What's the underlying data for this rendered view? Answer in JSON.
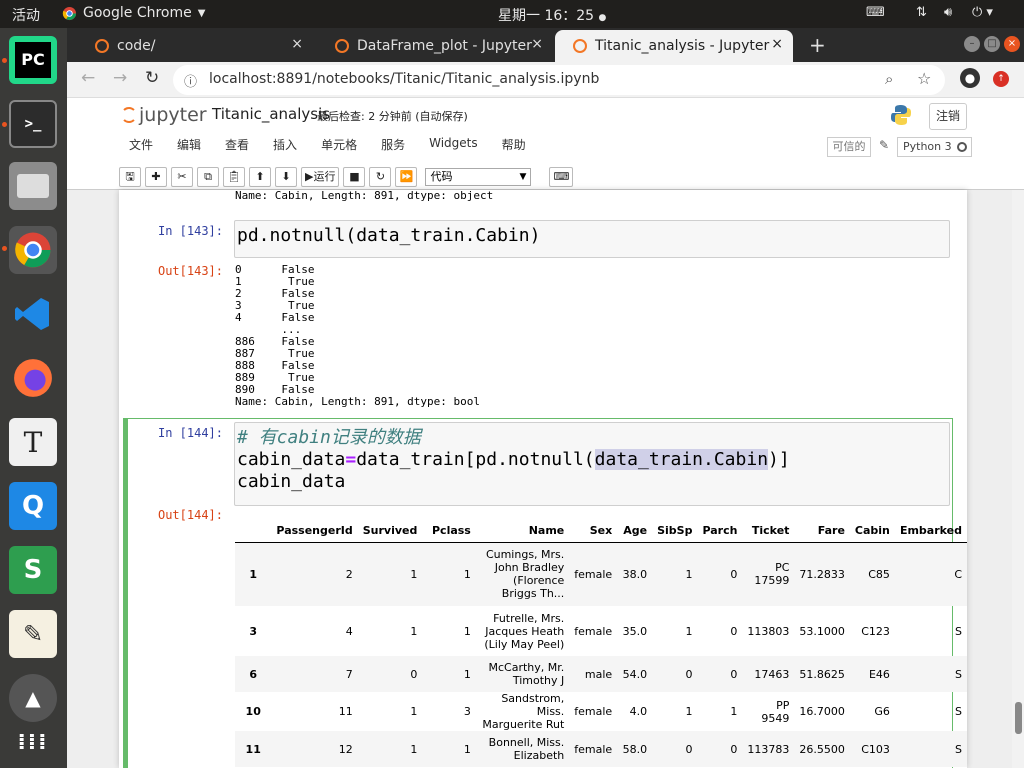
{
  "system": {
    "activities": "活动",
    "app_name": "Google Chrome",
    "clock": "星期一 16：25"
  },
  "dock": {
    "items": [
      "pycharm-icon",
      "terminal-icon",
      "files-icon",
      "chrome-icon",
      "vscode-icon",
      "firefox-icon",
      "typora-icon",
      "qq-icon",
      "spreadsheet-icon",
      "text-editor-icon",
      "software-updater-icon",
      "app-grid-icon"
    ]
  },
  "browser": {
    "tabs": [
      {
        "title": "code/",
        "close": "×"
      },
      {
        "title": "DataFrame_plot - Jupyter",
        "close": "×"
      },
      {
        "title": "Titanic_analysis - Jupyter",
        "close": "×"
      }
    ],
    "new_tab": "+",
    "url": "localhost:8891/notebooks/Titanic/Titanic_analysis.ipynb"
  },
  "jupyter": {
    "logo": "jupyter",
    "notebook_name": "Titanic_analysis",
    "checkpoint": "最后检查: 2 分钟前 (自动保存)",
    "logout": "注销",
    "menu": [
      "文件",
      "编辑",
      "查看",
      "插入",
      "单元格",
      "服务",
      "Widgets",
      "帮助"
    ],
    "trusted": "可信的",
    "kernel": "Python 3",
    "toolbar": {
      "run": "▶运行",
      "cell_type": "代码"
    }
  },
  "cells": {
    "prev_out_tail": "Name: Cabin, Length: 891, dtype: object",
    "c143": {
      "in_prompt": "In [143]:",
      "code": "pd.notnull(data_train.Cabin)",
      "out_prompt": "Out[143]:",
      "output": "0      False\n1       True\n2      False\n3       True\n4      False\n       ...\n886    False\n887     True\n888    False\n889     True\n890    False\nName: Cabin, Length: 891, dtype: bool"
    },
    "c144": {
      "in_prompt": "In [144]:",
      "comment": "# 有cabin记录的数据",
      "line2_a": "cabin_data",
      "line2_eq": "=",
      "line2_b": "data_train[pd.notnull(",
      "line2_hl": "data_train.Cabin",
      "line2_c": ")]",
      "line3": "cabin_data",
      "out_prompt": "Out[144]:"
    }
  },
  "dataframe": {
    "columns": [
      "",
      "PassengerId",
      "Survived",
      "Pclass",
      "Name",
      "Sex",
      "Age",
      "SibSp",
      "Parch",
      "Ticket",
      "Fare",
      "Cabin",
      "Embarked"
    ],
    "rows": [
      [
        "1",
        "2",
        "1",
        "1",
        "Cumings, Mrs. John Bradley (Florence Briggs Th...",
        "female",
        "38.0",
        "1",
        "0",
        "PC 17599",
        "71.2833",
        "C85",
        "C"
      ],
      [
        "3",
        "4",
        "1",
        "1",
        "Futrelle, Mrs. Jacques Heath (Lily May Peel)",
        "female",
        "35.0",
        "1",
        "0",
        "113803",
        "53.1000",
        "C123",
        "S"
      ],
      [
        "6",
        "7",
        "0",
        "1",
        "McCarthy, Mr. Timothy J",
        "male",
        "54.0",
        "0",
        "0",
        "17463",
        "51.8625",
        "E46",
        "S"
      ],
      [
        "10",
        "11",
        "1",
        "3",
        "Sandstrom, Miss. Marguerite Rut",
        "female",
        "4.0",
        "1",
        "1",
        "PP 9549",
        "16.7000",
        "G6",
        "S"
      ],
      [
        "11",
        "12",
        "1",
        "1",
        "Bonnell, Miss. Elizabeth",
        "female",
        "58.0",
        "0",
        "0",
        "113783",
        "26.5500",
        "C103",
        "S"
      ]
    ]
  }
}
